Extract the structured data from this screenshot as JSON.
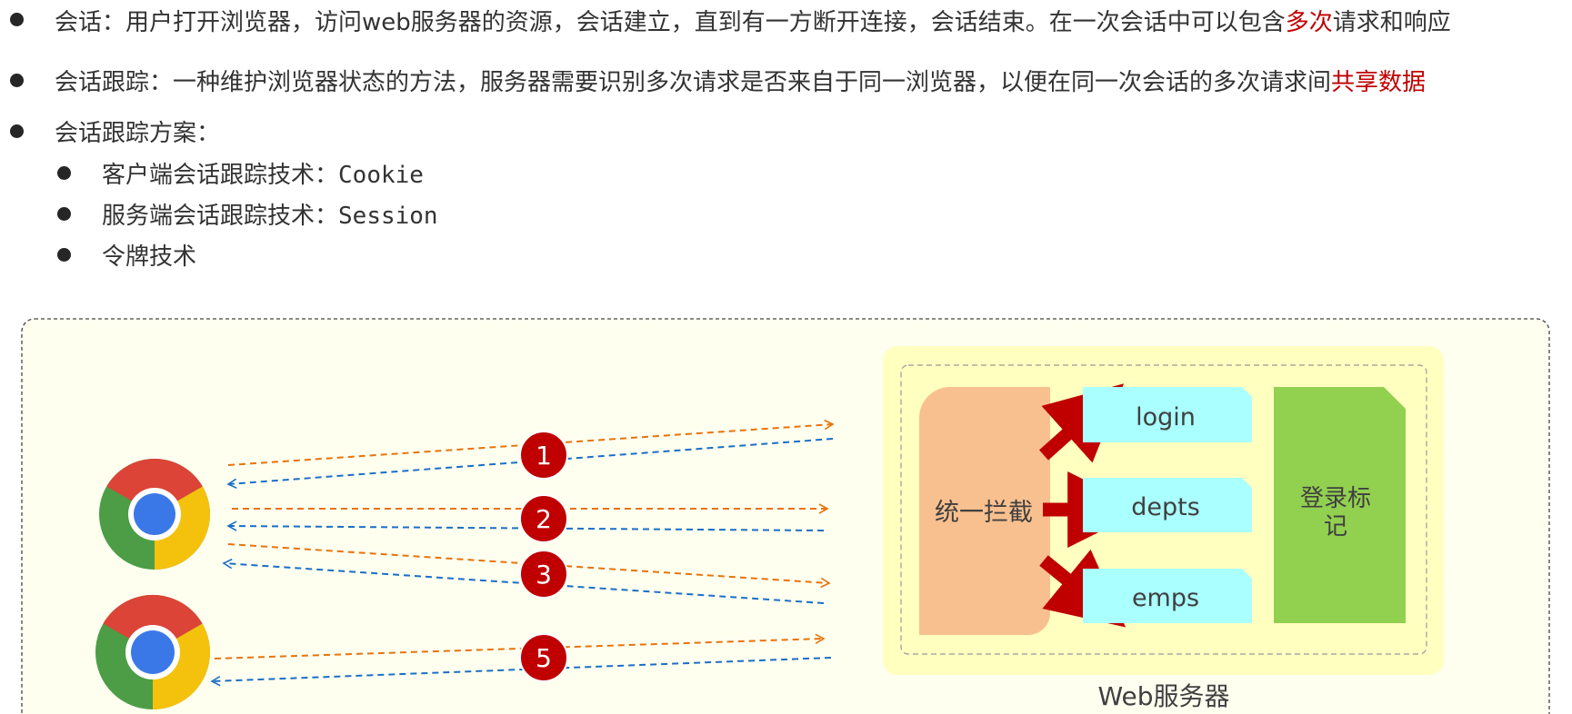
{
  "bullets": {
    "session": {
      "pre": "会话：用户打开浏览器，访问web服务器的资源，会话建立，直到有一方断开连接，会话结束。在一次会话中可以包含",
      "highlight": "多次",
      "post": "请求和响应"
    },
    "tracking": {
      "pre": "会话跟踪：一种维护浏览器状态的方法，服务器需要识别多次请求是否来自于同一浏览器，以便在同一次会话的多次请求间",
      "highlight": "共享数据",
      "post": ""
    },
    "schemes": {
      "title": "会话跟踪方案：",
      "items": [
        {
          "label": "客户端会话跟踪技术：",
          "tech": "Cookie"
        },
        {
          "label": "服务端会话跟踪技术：",
          "tech": "Session"
        },
        {
          "label": "令牌技术",
          "tech": ""
        }
      ]
    }
  },
  "diagram": {
    "steps": [
      "1",
      "2",
      "3",
      "5"
    ],
    "server": {
      "interceptor": "统一拦截",
      "resources": [
        "login",
        "depts",
        "emps"
      ],
      "login_flag": [
        "登录标",
        "记"
      ],
      "caption": "Web服务器"
    },
    "colors": {
      "request_arrow": "#e8730c",
      "response_arrow": "#1a6fc6",
      "step_badge": "#c00000",
      "interceptor": "#f9c08f",
      "resource": "#aaffff",
      "login_flag": "#92d050",
      "server_bg": "#ffffc0",
      "panel_bg": "#fffff0",
      "highlight_text": "#c00000"
    }
  }
}
